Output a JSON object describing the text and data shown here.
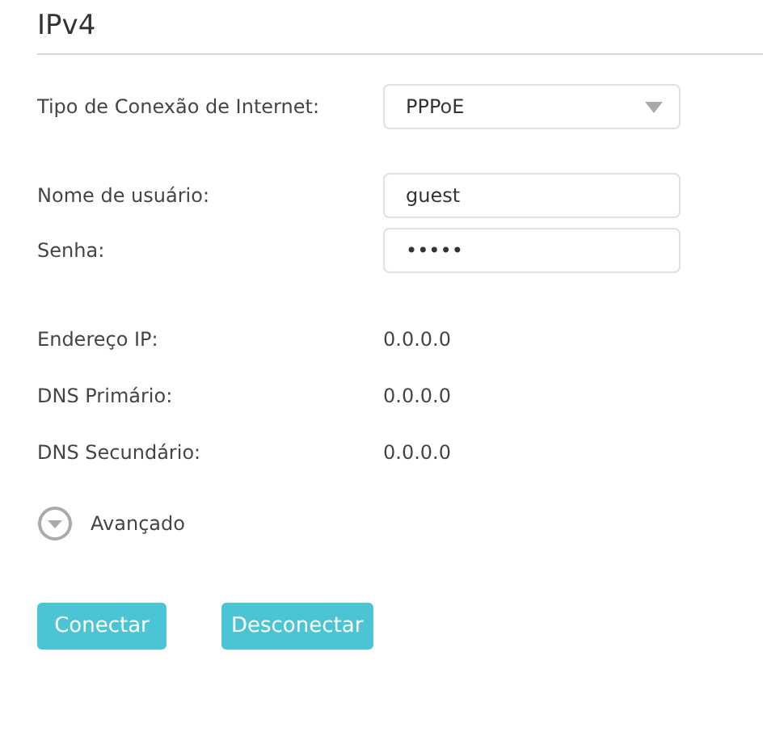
{
  "section_title": "IPv4",
  "connection_type": {
    "label": "Tipo de Conexão de Internet:",
    "value": "PPPoE"
  },
  "credentials": [
    {
      "label": "Nome de usuário:",
      "value": "guest"
    },
    {
      "label": "Senha:",
      "value": "•••••"
    }
  ],
  "status": [
    {
      "label": "Endereço IP:",
      "value": "0.0.0.0"
    },
    {
      "label": "DNS Primário:",
      "value": "0.0.0.0"
    },
    {
      "label": "DNS Secundário:",
      "value": "0.0.0.0"
    }
  ],
  "advanced": {
    "label": "Avançado",
    "expanded": false
  },
  "buttons": [
    "Conectar",
    "Desconectar"
  ]
}
